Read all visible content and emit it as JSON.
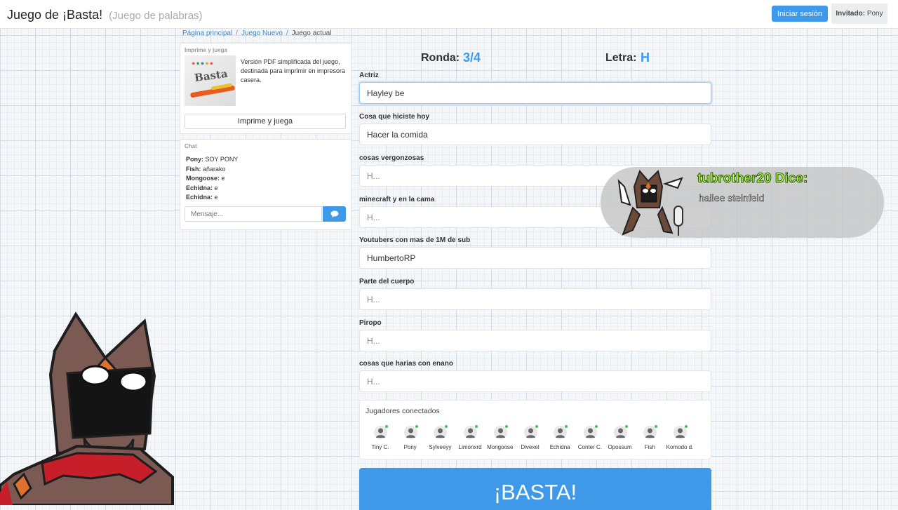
{
  "header": {
    "title": "Juego de ¡Basta!",
    "subtitle": "(Juego de palabras)",
    "login_label": "Iniciar sesión",
    "guest_label": "Invitado:",
    "guest_name": "Pony"
  },
  "breadcrumb": [
    "Página principal",
    "Juego Nuevo",
    "Juego actual"
  ],
  "print_card": {
    "title": "Imprime y juega",
    "description": "Versión PDF simplificada del juego, destinada para imprimir en impresora casera.",
    "button_label": "Imprime y juega",
    "thumb_text": "Basta"
  },
  "chat": {
    "title": "Chat",
    "messages": [
      {
        "user": "Pony:",
        "text": "SOY PONY"
      },
      {
        "user": "Fish:",
        "text": "añarako"
      },
      {
        "user": "Mongoose:",
        "text": "e"
      },
      {
        "user": "Echidna:",
        "text": "e"
      },
      {
        "user": "Echidna:",
        "text": "e"
      }
    ],
    "placeholder": "Mensaje...",
    "send_icon": "comment-icon"
  },
  "game": {
    "round_label": "Ronda:",
    "round_value": "3/4",
    "letter_label": "Letra:",
    "letter_value": "H"
  },
  "fields": [
    {
      "label": "Actriz",
      "value": "Hayley be",
      "placeholder": "H..."
    },
    {
      "label": "Cosa que hiciste hoy",
      "value": "Hacer la comida",
      "placeholder": "H..."
    },
    {
      "label": "cosas vergonzosas",
      "value": "",
      "placeholder": "H..."
    },
    {
      "label": "minecraft y en la cama",
      "value": "",
      "placeholder": "H..."
    },
    {
      "label": "Youtubers con mas de 1M de sub",
      "value": "HumbertoRP",
      "placeholder": "H..."
    },
    {
      "label": "Parte del cuerpo",
      "value": "",
      "placeholder": "H..."
    },
    {
      "label": "Piropo",
      "value": "",
      "placeholder": "H..."
    },
    {
      "label": "cosas que harias con enano",
      "value": "",
      "placeholder": "H..."
    }
  ],
  "players": {
    "title": "Jugadores conectados",
    "list": [
      "Tiny C.",
      "Pony",
      "Sylveeyy",
      "Limonxrd",
      "Mongoose",
      "Divexel",
      "Echidna",
      "Conter C.",
      "Opossum",
      "Fish",
      "Komodo d."
    ]
  },
  "basta_label": "¡BASTA!",
  "stream_overlay": {
    "username": "tubrother20 Dice:",
    "message": "hailee steinfeld"
  },
  "colors": {
    "accent": "#3e9ae8",
    "online": "#41c353",
    "overlay_name": "#b6ff3a"
  }
}
